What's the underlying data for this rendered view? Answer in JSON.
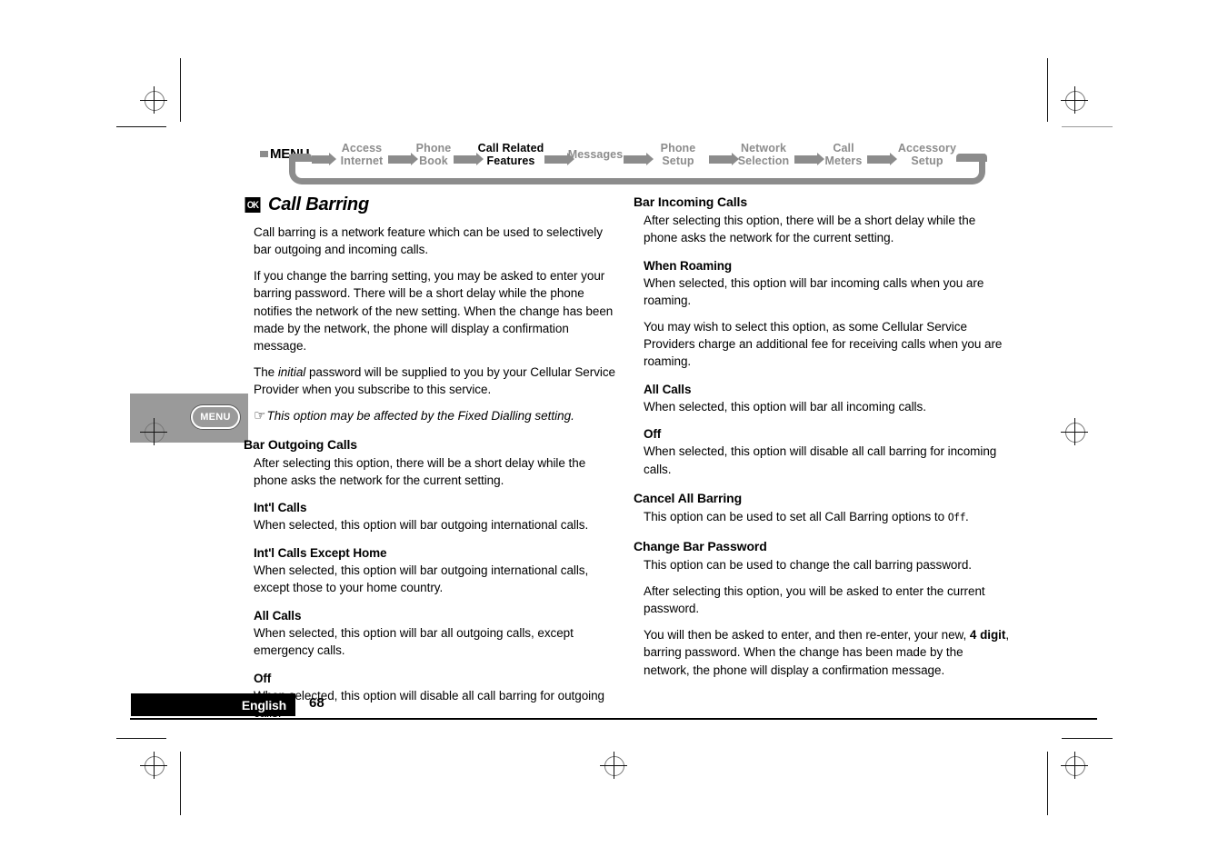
{
  "menu_flow": {
    "root_label": "MENU",
    "items": [
      {
        "line1": "Access",
        "line2": "Internet",
        "current": false
      },
      {
        "line1": "Phone",
        "line2": "Book",
        "current": false
      },
      {
        "line1": "Call Related",
        "line2": "Features",
        "current": true
      },
      {
        "line1": "Messages",
        "line2": "",
        "current": false
      },
      {
        "line1": "Phone",
        "line2": "Setup",
        "current": false
      },
      {
        "line1": "Network",
        "line2": "Selection",
        "current": false
      },
      {
        "line1": "Call",
        "line2": "Meters",
        "current": false
      },
      {
        "line1": "Accessory",
        "line2": "Setup",
        "current": false
      }
    ],
    "accent_color": "#8c8c8c"
  },
  "side_key": {
    "label": "MENU",
    "block_color": "#9a9a9a"
  },
  "left_column": {
    "ok_badge": "OK",
    "title": "Call Barring",
    "intro_1": "Call barring is a network feature which can be used to selectively bar outgoing and incoming calls.",
    "intro_2": "If you change the barring setting, you may be asked to enter your barring password. There will be a short delay while the phone notifies the network of the new setting. When the change has been made by the network, the phone will display a confirmation message.",
    "intro_3_pre": "The ",
    "intro_3_em": "initial",
    "intro_3_post": " password will be supplied to you by your Cellular Service Provider when you subscribe to this service.",
    "note_icon": "pointing-hand-icon",
    "note_text": "This option may be affected by the Fixed Dialling setting.",
    "section_head": "Bar Outgoing Calls",
    "section_body": "After selecting this option, there will be a short delay while the phone asks the network for the current setting.",
    "sub1_head": "Int'l Calls",
    "sub1_body": "When selected, this option will bar outgoing international calls.",
    "sub2_head": "Int'l Calls Except Home",
    "sub2_body": "When selected, this option will bar outgoing international calls, except those to your home country.",
    "sub3_head": "All Calls",
    "sub3_body": "When selected, this option will bar all outgoing calls, except emergency calls.",
    "sub4_head": "Off",
    "sub4_body": "When selected, this option will disable all call barring for outgoing calls."
  },
  "right_column": {
    "section_head": "Bar Incoming Calls",
    "section_body": "After selecting this option, there will be a short delay while the phone asks the network for the current setting.",
    "sub1_head": "When Roaming",
    "sub1_body_a": "When selected, this option will bar incoming calls when you are roaming.",
    "sub1_body_b": "You may wish to select this option, as some Cellular Service Providers charge an additional fee for receiving calls when you are roaming.",
    "sub2_head": "All Calls",
    "sub2_body": "When selected, this option will bar all incoming calls.",
    "sub3_head": "Off",
    "sub3_body": "When selected, this option will disable all call barring for incoming calls.",
    "section2_head": "Cancel All Barring",
    "section2_body_pre": "This option can be used to set all Call Barring options to ",
    "section2_body_lcd": "Off",
    "section2_body_post": ".",
    "section3_head": "Change Bar Password",
    "section3_body_a": "This option can be used to change the call barring password.",
    "section3_body_b": "After selecting this option, you will be asked to enter the current password.",
    "section3_body_c_pre": "You will then be asked to enter, and then re-enter, your new, ",
    "section3_body_c_bold": "4 digit",
    "section3_body_c_post": ", barring password. When the change has been made by the network, the phone will display a confirmation message."
  },
  "footer": {
    "language": "English",
    "page_number": "68"
  }
}
